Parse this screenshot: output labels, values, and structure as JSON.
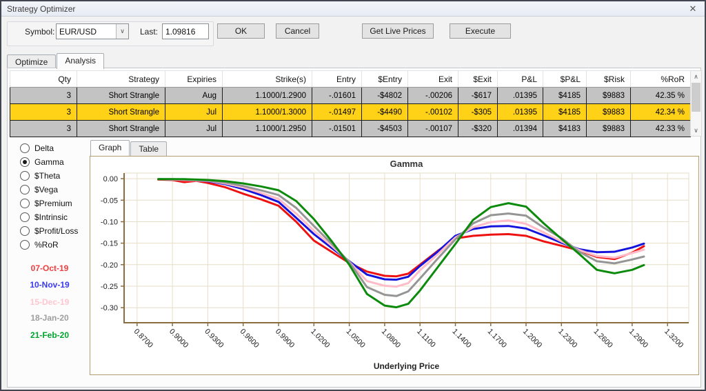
{
  "window": {
    "title": "Strategy Optimizer"
  },
  "icons": {
    "close": "✕",
    "dropdown_arrow": "∨",
    "scroll_up": "∧",
    "scroll_down": "∨"
  },
  "toolbar": {
    "symbol_label": "Symbol:",
    "symbol_value": "EUR/USD",
    "last_label": "Last:",
    "last_value": "1.09816",
    "ok_label": "OK",
    "cancel_label": "Cancel",
    "get_live_prices_label": "Get Live Prices",
    "execute_label": "Execute"
  },
  "tabs": {
    "optimize": "Optimize",
    "analysis": "Analysis",
    "active": "Analysis"
  },
  "grid": {
    "columns": [
      "Qty",
      "Strategy",
      "Expiries",
      "Strike(s)",
      "Entry",
      "$Entry",
      "Exit",
      "$Exit",
      "P&L",
      "$P&L",
      "$Risk",
      "%RoR"
    ],
    "rows": [
      {
        "selected": false,
        "cells": [
          "3",
          "Short Strangle",
          "Aug",
          "1.1000/1.2900",
          "-.01601",
          "-$4802",
          "-.00206",
          "-$617",
          ".01395",
          "$4185",
          "$9883",
          "42.35 %"
        ]
      },
      {
        "selected": true,
        "cells": [
          "3",
          "Short Strangle",
          "Jul",
          "1.1000/1.3000",
          "-.01497",
          "-$4490",
          "-.00102",
          "-$305",
          ".01395",
          "$4185",
          "$9883",
          "42.34 %"
        ]
      },
      {
        "selected": false,
        "cells": [
          "3",
          "Short Strangle",
          "Jul",
          "1.1000/1.2950",
          "-.01501",
          "-$4503",
          "-.00107",
          "-$320",
          ".01394",
          "$4183",
          "$9883",
          "42.33 %"
        ]
      }
    ],
    "selected_row_color": "#ffd117",
    "row_color": "#c3c3c3"
  },
  "metrics": {
    "options": [
      "Delta",
      "Gamma",
      "$Theta",
      "$Vega",
      "$Premium",
      "$Intrinsic",
      "$Profit/Loss",
      "%RoR"
    ],
    "selected": "Gamma"
  },
  "legend": {
    "dates": [
      {
        "label": "07-Oct-19",
        "color": "#f23d3d"
      },
      {
        "label": "10-Nov-19",
        "color": "#3939ee"
      },
      {
        "label": "15-Dec-19",
        "color": "#ffc6d0"
      },
      {
        "label": "18-Jan-20",
        "color": "#9e9e9e"
      },
      {
        "label": "21-Feb-20",
        "color": "#00a42e"
      }
    ]
  },
  "graph_tabs": {
    "graph": "Graph",
    "table": "Table",
    "active": "Graph"
  },
  "chart_data": {
    "type": "line",
    "title": "Gamma",
    "xlabel": "Underlying Price",
    "ylabel": "",
    "grid": true,
    "legend_position": "left-panel",
    "xlim": [
      0.859,
      1.338
    ],
    "ylim": [
      -0.335,
      0.013
    ],
    "x_ticks": [
      0.87,
      0.9,
      0.93,
      0.96,
      0.99,
      1.02,
      1.05,
      1.08,
      1.11,
      1.14,
      1.17,
      1.2,
      1.23,
      1.26,
      1.29,
      1.32
    ],
    "y_ticks": [
      0.0,
      -0.05,
      -0.1,
      -0.15,
      -0.2,
      -0.25,
      -0.3
    ],
    "x": [
      0.888,
      0.9,
      0.91,
      0.92,
      0.93,
      0.945,
      0.96,
      0.975,
      0.99,
      1.005,
      1.02,
      1.035,
      1.05,
      1.065,
      1.08,
      1.09,
      1.1,
      1.11,
      1.125,
      1.14,
      1.155,
      1.17,
      1.185,
      1.2,
      1.215,
      1.23,
      1.245,
      1.26,
      1.275,
      1.29,
      1.3
    ],
    "series": [
      {
        "name": "07-Oct-19",
        "color": "#ee1111",
        "values": [
          -0.002,
          -0.003,
          -0.008,
          -0.005,
          -0.01,
          -0.02,
          -0.035,
          -0.048,
          -0.063,
          -0.1,
          -0.144,
          -0.17,
          -0.196,
          -0.216,
          -0.226,
          -0.227,
          -0.221,
          -0.2,
          -0.168,
          -0.139,
          -0.133,
          -0.13,
          -0.129,
          -0.133,
          -0.146,
          -0.156,
          -0.167,
          -0.182,
          -0.187,
          -0.172,
          -0.157
        ]
      },
      {
        "name": "10-Nov-19",
        "color": "#1414dd",
        "values": [
          -0.001,
          -0.002,
          -0.003,
          -0.004,
          -0.006,
          -0.013,
          -0.024,
          -0.038,
          -0.054,
          -0.091,
          -0.129,
          -0.161,
          -0.192,
          -0.223,
          -0.234,
          -0.235,
          -0.228,
          -0.203,
          -0.17,
          -0.133,
          -0.117,
          -0.111,
          -0.11,
          -0.116,
          -0.132,
          -0.149,
          -0.164,
          -0.171,
          -0.17,
          -0.16,
          -0.151
        ]
      },
      {
        "name": "15-Dec-19",
        "color": "#ffbcc8",
        "values": [
          -0.001,
          -0.002,
          -0.003,
          -0.004,
          -0.005,
          -0.011,
          -0.02,
          -0.033,
          -0.047,
          -0.081,
          -0.121,
          -0.156,
          -0.193,
          -0.238,
          -0.249,
          -0.251,
          -0.243,
          -0.213,
          -0.176,
          -0.137,
          -0.113,
          -0.101,
          -0.097,
          -0.105,
          -0.125,
          -0.146,
          -0.166,
          -0.18,
          -0.184,
          -0.173,
          -0.165
        ]
      },
      {
        "name": "18-Jan-20",
        "color": "#959595",
        "values": [
          -0.001,
          -0.001,
          -0.002,
          -0.003,
          -0.004,
          -0.009,
          -0.017,
          -0.027,
          -0.038,
          -0.068,
          -0.11,
          -0.151,
          -0.194,
          -0.252,
          -0.27,
          -0.273,
          -0.262,
          -0.232,
          -0.186,
          -0.141,
          -0.104,
          -0.085,
          -0.081,
          -0.086,
          -0.114,
          -0.138,
          -0.17,
          -0.192,
          -0.197,
          -0.188,
          -0.181
        ]
      },
      {
        "name": "21-Feb-20",
        "color": "#0b8a0b",
        "values": [
          -0.001,
          -0.001,
          -0.001,
          -0.002,
          -0.003,
          -0.006,
          -0.011,
          -0.018,
          -0.027,
          -0.052,
          -0.094,
          -0.145,
          -0.2,
          -0.268,
          -0.295,
          -0.299,
          -0.291,
          -0.26,
          -0.206,
          -0.152,
          -0.096,
          -0.066,
          -0.057,
          -0.065,
          -0.104,
          -0.14,
          -0.175,
          -0.212,
          -0.22,
          -0.212,
          -0.201
        ]
      }
    ]
  }
}
